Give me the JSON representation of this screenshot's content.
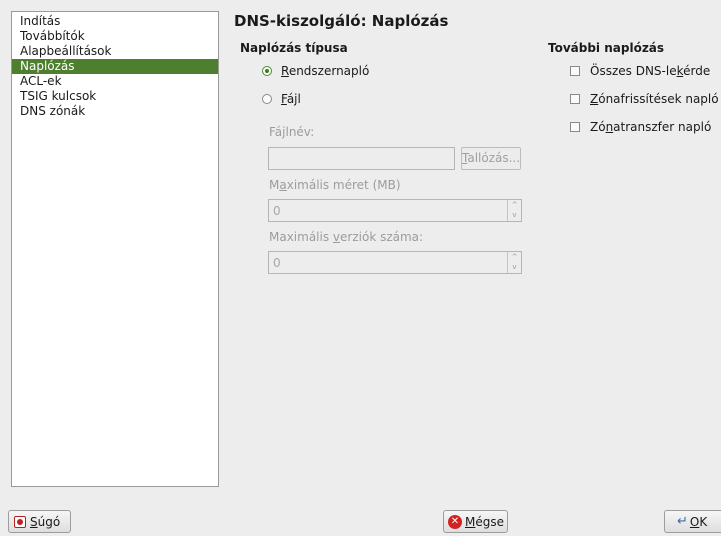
{
  "nav": {
    "items": [
      {
        "label": "Indítás"
      },
      {
        "label": "Továbbítók"
      },
      {
        "label": "Alapbeállítások"
      },
      {
        "label": "Naplózás"
      },
      {
        "label": "ACL-ek"
      },
      {
        "label": "TSIG kulcsok"
      },
      {
        "label": "DNS zónák"
      }
    ],
    "selected_index": 3
  },
  "page": {
    "title": "DNS-kiszolgáló: Naplózás"
  },
  "log_type": {
    "title": "Naplózás típusa",
    "syslog": {
      "accel": "R",
      "rest": "endszernapló",
      "selected": true
    },
    "file": {
      "accel": "F",
      "rest": "ájl",
      "selected": false
    }
  },
  "file_opts": {
    "filename_label": "Fájlnév:",
    "filename_value": "",
    "browse": {
      "pre": "",
      "accel": "T",
      "rest": "allózás..."
    },
    "maxsize": {
      "pre": "M",
      "accel": "a",
      "rest": "ximális méret (MB)",
      "value": "0"
    },
    "maxver": {
      "pre": "Maximális ",
      "accel": "v",
      "rest": "erziók száma:",
      "value": "0"
    }
  },
  "extra": {
    "title": "További naplózás",
    "all_queries": {
      "pre": "Összes DNS-le",
      "accel": "k",
      "rest": "érde",
      "checked": false
    },
    "zone_updates": {
      "pre": "",
      "accel": "Z",
      "rest": "ónafrissítések napló",
      "checked": false
    },
    "zone_transfers": {
      "pre": "Zó",
      "accel": "n",
      "rest": "atranszfer napló",
      "checked": false
    }
  },
  "footer": {
    "help": {
      "accel": "S",
      "rest": "úgó",
      "icon": "help-icon"
    },
    "cancel": {
      "accel": "M",
      "rest": "égse",
      "icon": "cancel-icon"
    },
    "ok": {
      "accel": "O",
      "rest": "K",
      "icon": "ok-arrow-icon"
    }
  },
  "colors": {
    "accent": "#4e7f2f",
    "background": "#ededed"
  }
}
